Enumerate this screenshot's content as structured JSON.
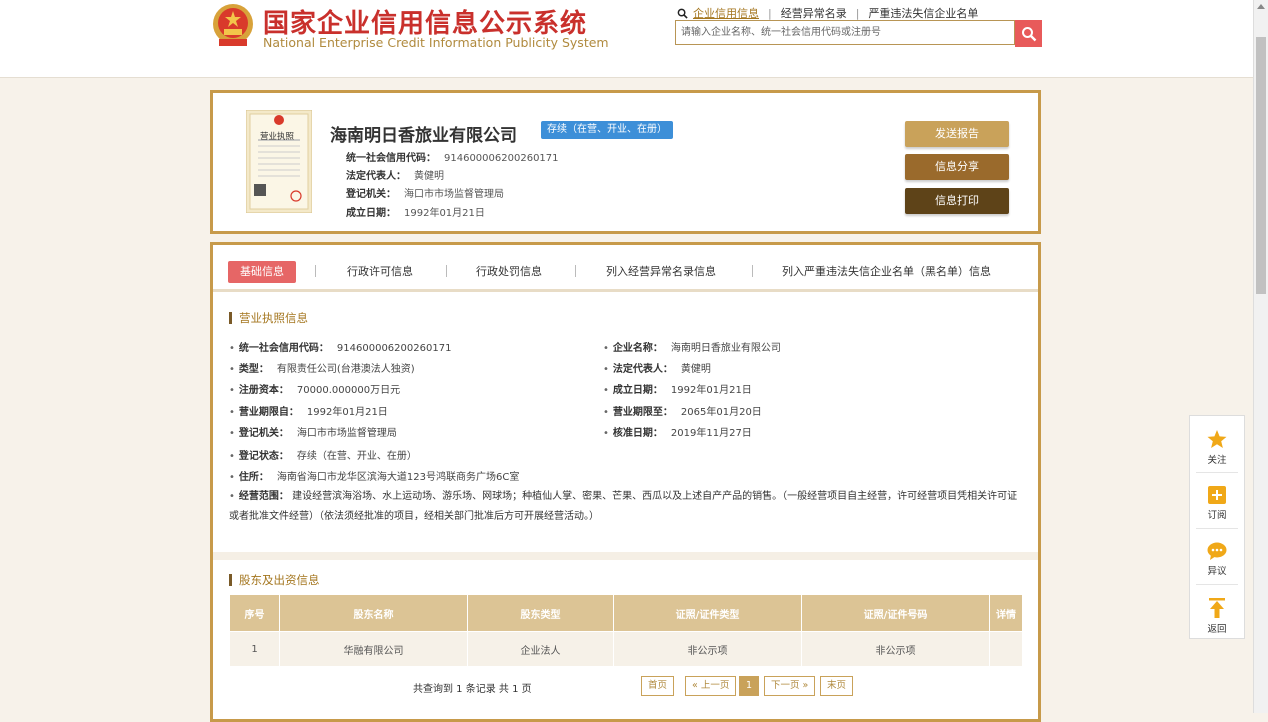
{
  "header": {
    "title": "国家企业信用信息公示系统",
    "subtitle": "National Enterprise Credit Information Publicity System",
    "nav_links": [
      "企业信用信息",
      "经营异常名录",
      "严重违法失信企业名单"
    ],
    "search_placeholder": "请输入企业名称、统一社会信用代码或注册号"
  },
  "company": {
    "license_caption": "营业执照",
    "name": "海南明日香旅业有限公司",
    "status": "存续（在营、开业、在册）",
    "info": [
      {
        "label": "统一社会信用代码：",
        "value": "914600006200260171"
      },
      {
        "label": "法定代表人：",
        "value": "黄健明"
      },
      {
        "label": "登记机关：",
        "value": "海口市市场监督管理局"
      },
      {
        "label": "成立日期：",
        "value": "1992年01月21日"
      }
    ],
    "buttons": {
      "report": "发送报告",
      "share": "信息分享",
      "print": "信息打印"
    }
  },
  "tabs": [
    "基础信息",
    "行政许可信息",
    "行政处罚信息",
    "列入经营异常名录信息",
    "列入严重违法失信企业名单（黑名单）信息"
  ],
  "license_section": {
    "title": "营业执照信息",
    "left": [
      {
        "label": "统一社会信用代码：",
        "value": "914600006200260171"
      },
      {
        "label": "类型：",
        "value": "有限责任公司(台港澳法人独资)"
      },
      {
        "label": "注册资本：",
        "value": "70000.000000万日元"
      },
      {
        "label": "营业期限自：",
        "value": "1992年01月21日"
      },
      {
        "label": "登记机关：",
        "value": "海口市市场监督管理局"
      },
      {
        "label": "登记状态：",
        "value": "存续（在营、开业、在册）"
      },
      {
        "label": "住所：",
        "value": "海南省海口市龙华区滨海大道123号鸿联商务广场6C室"
      }
    ],
    "right": [
      {
        "label": "企业名称：",
        "value": "海南明日香旅业有限公司"
      },
      {
        "label": "法定代表人：",
        "value": "黄健明"
      },
      {
        "label": "成立日期：",
        "value": "1992年01月21日"
      },
      {
        "label": "营业期限至：",
        "value": "2065年01月20日"
      },
      {
        "label": "核准日期：",
        "value": "2019年11月27日"
      }
    ],
    "scope_label": "经营范围：",
    "scope_value": "建设经营滨海浴场、水上运动场、游乐场、网球场；种植仙人掌、密果、芒果、西瓜以及上述自产产品的销售。（一般经营项目自主经营，许可经营项目凭相关许可证或者批准文件经营）（依法须经批准的项目，经相关部门批准后方可开展经营活动。）"
  },
  "shareholders": {
    "title": "股东及出资信息",
    "columns": [
      "序号",
      "股东名称",
      "股东类型",
      "证照/证件类型",
      "证照/证件号码",
      "详情"
    ],
    "rows": [
      [
        "1",
        "华融有限公司",
        "企业法人",
        "非公示项",
        "非公示项",
        ""
      ]
    ],
    "pager_info": "共查询到 1 条记录 共 1 页",
    "pager": {
      "first": "首页",
      "prev": "« 上一页",
      "current": "1",
      "next": "下一页 »",
      "last": "末页"
    }
  },
  "float_panel": [
    "关注",
    "订阅",
    "异议",
    "返回"
  ]
}
